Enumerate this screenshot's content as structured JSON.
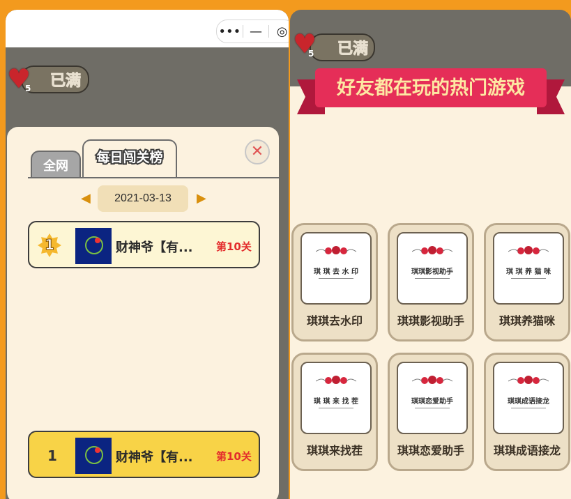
{
  "left": {
    "capsule": {
      "more_icon": "•••",
      "minimize_icon": "—",
      "target_icon": "◎"
    },
    "hearts": {
      "count": "5",
      "status": "已满"
    },
    "popup": {
      "tabs": [
        "全网",
        "每日闯关榜"
      ],
      "close_icon": "✕",
      "date": "2021-03-13",
      "prev_icon": "◀",
      "next_icon": "▶",
      "rows": [
        {
          "rank": "1",
          "name": "财神爷【有...",
          "level": "第10关"
        }
      ],
      "my_row": {
        "rank": "1",
        "name": "财神爷【有...",
        "level": "第10关"
      }
    }
  },
  "right": {
    "hearts": {
      "count": "5",
      "status": "已满"
    },
    "banner": "好友都在玩的热门游戏",
    "games": [
      {
        "label": "琪琪去水印",
        "thumb": "琪 琪 去 水 印"
      },
      {
        "label": "琪琪影视助手",
        "thumb": "琪琪影视助手"
      },
      {
        "label": "琪琪养猫咪",
        "thumb": "琪 琪 养 猫 咪"
      },
      {
        "label": "琪琪来找茬",
        "thumb": "琪 琪 来 找 茬"
      },
      {
        "label": "琪琪恋爱助手",
        "thumb": "琪琪恋爱助手"
      },
      {
        "label": "琪琪成语接龙",
        "thumb": "琪琪成语接龙"
      }
    ]
  },
  "colors": {
    "accent": "#f39a1e",
    "banner": "#e52e58",
    "level_red": "#e32c2c",
    "my_row": "#f8d347"
  }
}
